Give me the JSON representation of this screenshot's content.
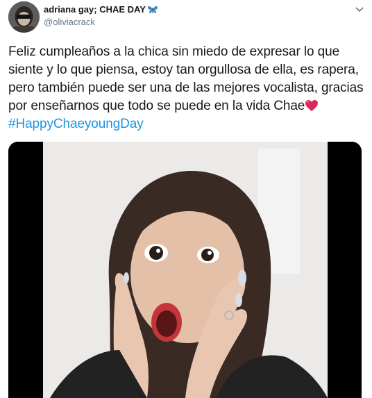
{
  "author": {
    "display_name": "adriana gay; CHAE DAY",
    "handle": "@oliviacrack",
    "name_emoji": "butterfly-icon"
  },
  "tweet": {
    "text_main": "Feliz cumpleaños a la chica sin miedo de expresar lo que siente y lo que piensa, estoy tan orgullosa de ella, es rapera, pero también puede ser una de las mejores vocalista, gracias por enseñarnos que todo se puede en la vida Chae",
    "inline_emoji": "heart-icon",
    "hashtag": "#HappyChaeyoungDay"
  },
  "colors": {
    "hashtag": "#1b95e0",
    "handle": "#657786",
    "text": "#14171a",
    "heart": "#e0245e",
    "butterfly": "#3b88c3"
  }
}
